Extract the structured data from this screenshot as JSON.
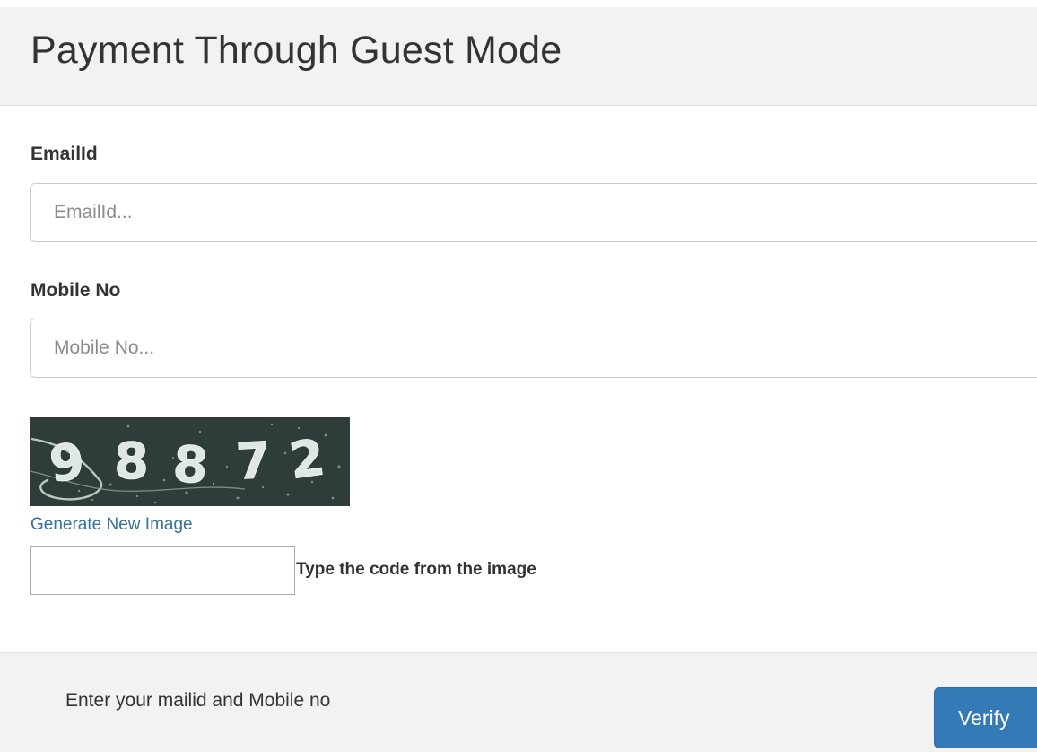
{
  "header": {
    "title": "Payment Through Guest Mode"
  },
  "form": {
    "email": {
      "label": "EmailId",
      "placeholder": "EmailId...",
      "value": ""
    },
    "mobile": {
      "label": "Mobile No",
      "placeholder": "Mobile No...",
      "value": ""
    },
    "captcha": {
      "code": "98872",
      "generate_link": "Generate New Image",
      "input_value": "",
      "hint": "Type the code from the image"
    }
  },
  "footer": {
    "message": "Enter your mailid and Mobile no",
    "verify_label": "Verify"
  },
  "colors": {
    "header_bg": "#f2f2f2",
    "link": "#33729a",
    "primary_button": "#337ab7",
    "captcha_bg": "#2e3d39"
  }
}
